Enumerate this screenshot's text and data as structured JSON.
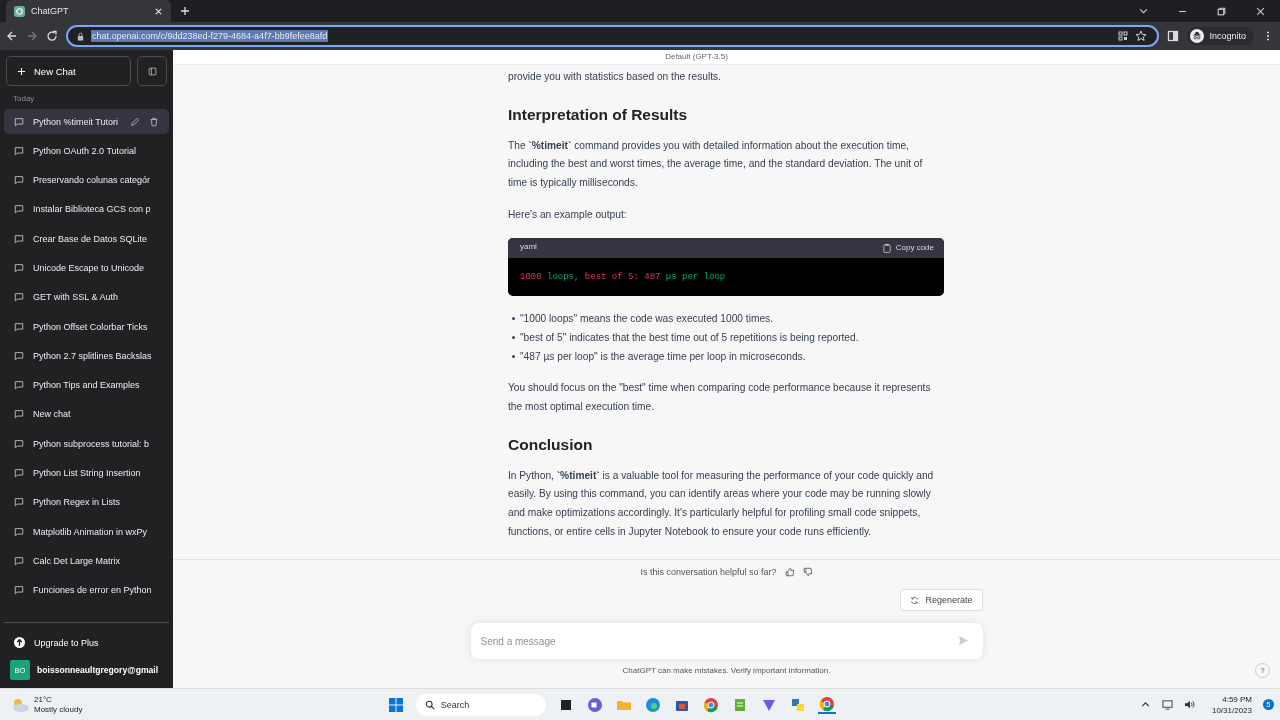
{
  "browser": {
    "tab_title": "ChatGPT",
    "url": "chat.openai.com/c/9dd238ed-f279-4684-a4f7-bb9fefee8afd",
    "url_selected": true,
    "profile": "Incognito"
  },
  "sidebar": {
    "new_chat": "New Chat",
    "section": "Today",
    "chats": [
      {
        "title": "Python %timeit Tutori",
        "selected": true
      },
      {
        "title": "Python OAuth 2.0 Tutorial",
        "selected": false
      },
      {
        "title": "Preservando colunas categór",
        "selected": false
      },
      {
        "title": "Instalar Biblioteca GCS con p",
        "selected": false
      },
      {
        "title": "Crear Base de Datos SQLite",
        "selected": false
      },
      {
        "title": "Unicode Escape to Unicode",
        "selected": false
      },
      {
        "title": "GET with SSL & Auth",
        "selected": false
      },
      {
        "title": "Python Offset Colorbar Ticks",
        "selected": false
      },
      {
        "title": "Python 2.7 splitlines Backslas",
        "selected": false
      },
      {
        "title": "Python Tips and Examples",
        "selected": false
      },
      {
        "title": "New chat",
        "selected": false
      },
      {
        "title": "Python subprocess tutorial: b",
        "selected": false
      },
      {
        "title": "Python List String Insertion",
        "selected": false
      },
      {
        "title": "Python Regex in Lists",
        "selected": false
      },
      {
        "title": "Matplotlib Animation in wxPy",
        "selected": false
      },
      {
        "title": "Calc Det Large Matrix",
        "selected": false
      },
      {
        "title": "Funciones de error en Python",
        "selected": false
      }
    ],
    "upgrade": "Upgrade to Plus",
    "user": {
      "initials": "BO",
      "email": "boissonneaultgregory@gmail"
    }
  },
  "main": {
    "model_label": "Default (GPT-3.5)",
    "blocks": [
      {
        "kind": "paragraph",
        "text": "provide you with statistics based on the results."
      },
      {
        "kind": "heading",
        "text": "Interpretation of Results"
      },
      {
        "kind": "paragraph",
        "text": "The **`%timeit`** command provides you with detailed information about the execution time, including the best and worst times, the average time, and the standard deviation. The unit of time is typically milliseconds."
      },
      {
        "kind": "paragraph",
        "text": "Here's an example output:"
      },
      {
        "kind": "code",
        "language": "yaml",
        "copy": "Copy code",
        "tokens": [
          {
            "text": "1000",
            "kind": "number"
          },
          {
            "text": " loops, ",
            "kind": "string"
          },
          {
            "text": "best of 5: 487",
            "kind": "number"
          },
          {
            "text": " µs per loop",
            "kind": "string"
          }
        ]
      },
      {
        "kind": "bullets",
        "items": [
          "\"1000 loops\" means the code was executed 1000 times.",
          "\"best of 5\" indicates that the best time out of 5 repetitions is being reported.",
          "\"487 µs per loop\" is the average time per loop in microseconds."
        ]
      },
      {
        "kind": "paragraph",
        "text": "You should focus on the \"best\" time when comparing code performance because it represents the most optimal execution time."
      },
      {
        "kind": "heading",
        "text": "Conclusion"
      },
      {
        "kind": "paragraph",
        "text": "In Python, **`%timeit`** is a valuable tool for measuring the performance of your code quickly and easily. By using this command, you can identify areas where your code may be running slowly and make optimizations accordingly. It's particularly helpful for profiling small code snippets, functions, or entire cells in Jupyter Notebook to ensure your code runs efficiently."
      }
    ],
    "feedback": "Is this conversation helpful so far?",
    "regenerate": "Regenerate",
    "input_placeholder": "Send a message",
    "disclaimer": "ChatGPT can make mistakes. Verify important information.",
    "help": "?"
  },
  "taskbar": {
    "temperature": "21°C",
    "weather": "Mostly cloudy",
    "search_placeholder": "Search",
    "time": "4:59 PM",
    "date": "10/31/2023",
    "notifications": "5"
  }
}
